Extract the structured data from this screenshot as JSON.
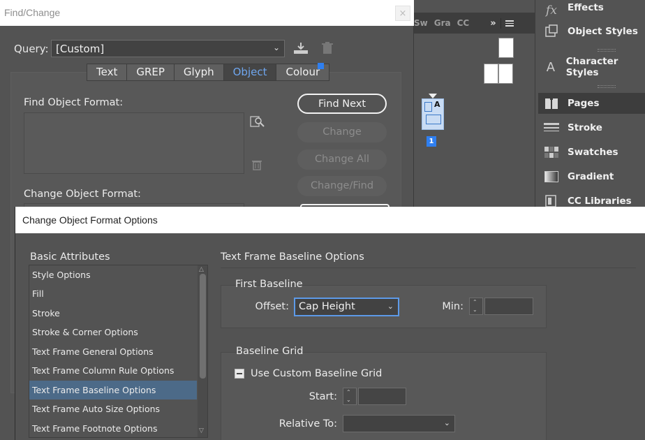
{
  "find_change": {
    "title": "Find/Change",
    "close_glyph": "×",
    "query_label": "Query:",
    "query_value": "[Custom]",
    "tabs": [
      {
        "label": "Text"
      },
      {
        "label": "GREP"
      },
      {
        "label": "Glyph"
      },
      {
        "label": "Object",
        "active": true
      },
      {
        "label": "Colour"
      }
    ],
    "find_label": "Find Object Format:",
    "change_label": "Change Object Format:",
    "buttons": {
      "find_next": "Find Next",
      "change": "Change",
      "change_all": "Change All",
      "change_find": "Change/Find"
    }
  },
  "panel_tabs": [
    "Sw",
    "Gra",
    "CC"
  ],
  "panel_menu": "»",
  "pages_panel": {
    "master_letter": "A",
    "page_number": "1"
  },
  "dock": {
    "items": [
      {
        "label": "Effects",
        "icon": "fx-icon"
      },
      {
        "label": "Object Styles",
        "icon": "object-styles-icon"
      },
      {
        "label": "Character Styles",
        "icon": "character-styles-icon"
      },
      {
        "label": "Pages",
        "icon": "pages-icon"
      },
      {
        "label": "Stroke",
        "icon": "stroke-icon"
      },
      {
        "label": "Swatches",
        "icon": "swatches-icon"
      },
      {
        "label": "Gradient",
        "icon": "gradient-icon"
      },
      {
        "label": "CC Libraries",
        "icon": "cc-libraries-icon"
      }
    ]
  },
  "format_options": {
    "title": "Change Object Format Options",
    "list_label": "Basic Attributes",
    "list_items": [
      "Style Options",
      "Fill",
      "Stroke",
      "Stroke & Corner Options",
      "Text Frame General Options",
      "Text Frame Column Rule Options",
      "Text Frame Baseline Options",
      "Text Frame Auto Size Options",
      "Text Frame Footnote Options"
    ],
    "selected_item": "Text Frame Baseline Options",
    "panel_title": "Text Frame Baseline Options",
    "first_baseline": {
      "label": "First Baseline",
      "offset_label": "Offset:",
      "offset_value": "Cap Height",
      "min_label": "Min:",
      "min_value": ""
    },
    "baseline_grid": {
      "label": "Baseline Grid",
      "use_custom_label": "Use Custom Baseline Grid",
      "start_label": "Start:",
      "start_value": "",
      "relative_to_label": "Relative To:",
      "relative_to_value": ""
    }
  },
  "colors": {
    "ui_bg": "#535353",
    "selection": "#4c6a88",
    "accent_blue": "#2f7ff0",
    "active_tab_text": "#6fa6ee"
  }
}
